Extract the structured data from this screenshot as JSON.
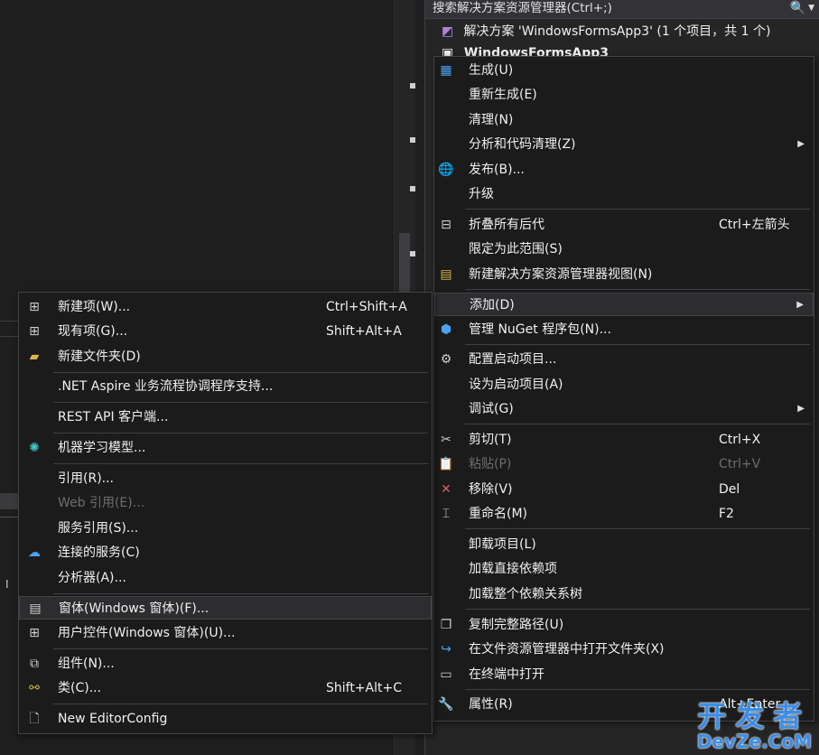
{
  "solution_explorer": {
    "search_placeholder": "搜索解决方案资源管理器(Ctrl+;)",
    "search_icon": "🔍",
    "solution_label": "解决方案 'WindowsFormsApp3' (1 个项目，共 1 个)",
    "project_label": "WindowsFormsApp3"
  },
  "context_menu": {
    "items": [
      {
        "label": "生成(U)",
        "shortcut": "",
        "icon": "build-icon"
      },
      {
        "label": "重新生成(E)",
        "shortcut": ""
      },
      {
        "label": "清理(N)",
        "shortcut": ""
      },
      {
        "label": "分析和代码清理(Z)",
        "shortcut": "",
        "submenu": true
      },
      {
        "label": "发布(B)...",
        "shortcut": "",
        "icon": "publish-globe-icon"
      },
      {
        "label": "升级",
        "shortcut": ""
      },
      {
        "label": "折叠所有后代",
        "shortcut": "Ctrl+左箭头",
        "icon": "collapse-icon"
      },
      {
        "label": "限定为此范围(S)",
        "shortcut": ""
      },
      {
        "label": "新建解决方案资源管理器视图(N)",
        "shortcut": "",
        "icon": "new-view-icon"
      },
      {
        "label": "添加(D)",
        "shortcut": "",
        "submenu": true
      },
      {
        "label": "管理 NuGet 程序包(N)...",
        "shortcut": "",
        "icon": "nuget-icon"
      },
      {
        "label": "配置启动项目...",
        "shortcut": "",
        "icon": "gear-icon"
      },
      {
        "label": "设为启动项目(A)",
        "shortcut": ""
      },
      {
        "label": "调试(G)",
        "shortcut": "",
        "submenu": true
      },
      {
        "label": "剪切(T)",
        "shortcut": "Ctrl+X",
        "icon": "scissors-icon"
      },
      {
        "label": "粘贴(P)",
        "shortcut": "Ctrl+V",
        "icon": "paste-icon",
        "disabled": true
      },
      {
        "label": "移除(V)",
        "shortcut": "Del",
        "icon": "remove-x-icon"
      },
      {
        "label": "重命名(M)",
        "shortcut": "F2",
        "icon": "rename-icon"
      },
      {
        "label": "卸载项目(L)",
        "shortcut": ""
      },
      {
        "label": "加载直接依赖项",
        "shortcut": ""
      },
      {
        "label": "加载整个依赖关系树",
        "shortcut": ""
      },
      {
        "label": "复制完整路径(U)",
        "shortcut": "",
        "icon": "copy-icon"
      },
      {
        "label": "在文件资源管理器中打开文件夹(X)",
        "shortcut": "",
        "icon": "open-folder-arrow-icon"
      },
      {
        "label": "在终端中打开",
        "shortcut": "",
        "icon": "terminal-icon"
      },
      {
        "label": "属性(R)",
        "shortcut": "Alt+Enter",
        "icon": "wrench-icon"
      }
    ]
  },
  "add_submenu": {
    "items": [
      {
        "label": "新建项(W)...",
        "shortcut": "Ctrl+Shift+A",
        "icon": "new-item-icon"
      },
      {
        "label": "现有项(G)...",
        "shortcut": "Shift+Alt+A",
        "icon": "existing-item-icon"
      },
      {
        "label": "新建文件夹(D)",
        "shortcut": "",
        "icon": "new-folder-icon"
      },
      {
        "label": ".NET Aspire 业务流程协调程序支持...",
        "shortcut": ""
      },
      {
        "label": "REST API 客户端...",
        "shortcut": ""
      },
      {
        "label": "机器学习模型...",
        "shortcut": "",
        "icon": "ml-model-icon"
      },
      {
        "label": "引用(R)...",
        "shortcut": ""
      },
      {
        "label": "Web 引用(E)...",
        "shortcut": "",
        "disabled": true
      },
      {
        "label": "服务引用(S)...",
        "shortcut": ""
      },
      {
        "label": "连接的服务(C)",
        "shortcut": "",
        "icon": "connected-service-icon"
      },
      {
        "label": "分析器(A)...",
        "shortcut": ""
      },
      {
        "label": "窗体(Windows 窗体)(F)...",
        "shortcut": "",
        "icon": "form-icon"
      },
      {
        "label": "用户控件(Windows 窗体)(U)...",
        "shortcut": "",
        "icon": "user-control-icon"
      },
      {
        "label": "组件(N)...",
        "shortcut": "",
        "icon": "component-icon"
      },
      {
        "label": "类(C)...",
        "shortcut": "Shift+Alt+C",
        "icon": "class-icon"
      },
      {
        "label": "New EditorConfig",
        "shortcut": "",
        "icon": "file-icon"
      }
    ]
  },
  "watermark": {
    "top": "开发者",
    "bottom": "DevZe.CoM"
  }
}
